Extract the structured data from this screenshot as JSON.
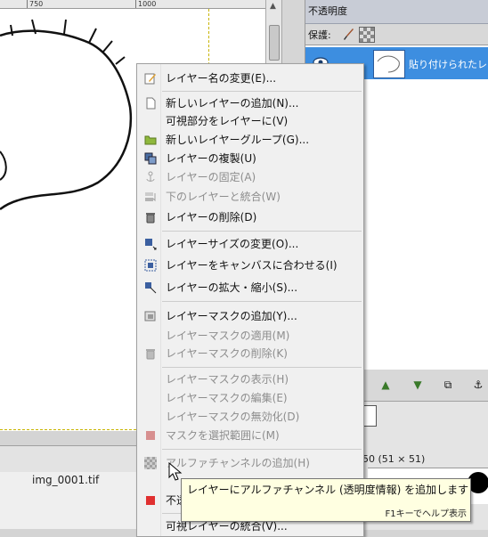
{
  "ruler": {
    "ticks": [
      "750",
      "1000"
    ]
  },
  "image_tab": {
    "filename": "img_0001.tif"
  },
  "dock": {
    "opacity_label": "不透明度",
    "lock_label": "保護:",
    "layer_name": "貼り付けられたレイ",
    "brush_size": "50 (51 × 51)"
  },
  "context_menu": {
    "items": [
      {
        "label": "レイヤー名の変更(E)...",
        "icon": "edit-icon",
        "enabled": true
      },
      {
        "label": "新しいレイヤーの追加(N)...",
        "icon": "new-document-icon",
        "enabled": true
      },
      {
        "label": "可視部分をレイヤーに(V)",
        "icon": "",
        "enabled": true
      },
      {
        "label": "新しいレイヤーグループ(G)...",
        "icon": "folder-icon",
        "enabled": true
      },
      {
        "label": "レイヤーの複製(U)",
        "icon": "duplicate-icon",
        "enabled": true
      },
      {
        "label": "レイヤーの固定(A)",
        "icon": "anchor-icon",
        "enabled": false
      },
      {
        "label": "下のレイヤーと統合(W)",
        "icon": "merge-down-icon",
        "enabled": false
      },
      {
        "label": "レイヤーの削除(D)",
        "icon": "trash-icon",
        "enabled": true
      },
      {
        "label": "レイヤーサイズの変更(O)...",
        "icon": "resize-icon",
        "enabled": true
      },
      {
        "label": "レイヤーをキャンバスに合わせる(I)",
        "icon": "fit-canvas-icon",
        "enabled": true
      },
      {
        "label": "レイヤーの拡大・縮小(S)...",
        "icon": "scale-icon",
        "enabled": true
      },
      {
        "label": "レイヤーマスクの追加(Y)...",
        "icon": "add-mask-icon",
        "enabled": true
      },
      {
        "label": "レイヤーマスクの適用(M)",
        "icon": "",
        "enabled": false
      },
      {
        "label": "レイヤーマスクの削除(K)",
        "icon": "trash-icon",
        "enabled": false
      },
      {
        "label": "レイヤーマスクの表示(H)",
        "icon": "",
        "enabled": false
      },
      {
        "label": "レイヤーマスクの編集(E)",
        "icon": "",
        "enabled": false
      },
      {
        "label": "レイヤーマスクの無効化(D)",
        "icon": "",
        "enabled": false
      },
      {
        "label": "マスクを選択範囲に(M)",
        "icon": "mask-to-selection-icon",
        "enabled": false
      },
      {
        "label": "アルファチャンネルの追加(H)",
        "icon": "alpha-channel-icon",
        "enabled": false
      },
      {
        "label": "不透",
        "icon": "red-square-icon",
        "enabled": true
      },
      {
        "label": "可視レイヤーの統合(V)...",
        "icon": "",
        "enabled": true
      }
    ]
  },
  "tooltip": {
    "text": "レイヤーにアルファチャンネル (透明度情報) を追加します",
    "hint": "F1キーでヘルプ表示"
  },
  "colors": {
    "selection": "#3d8ee0",
    "menu_bg": "#f0f0f0",
    "tooltip_bg": "#ffffe1"
  }
}
